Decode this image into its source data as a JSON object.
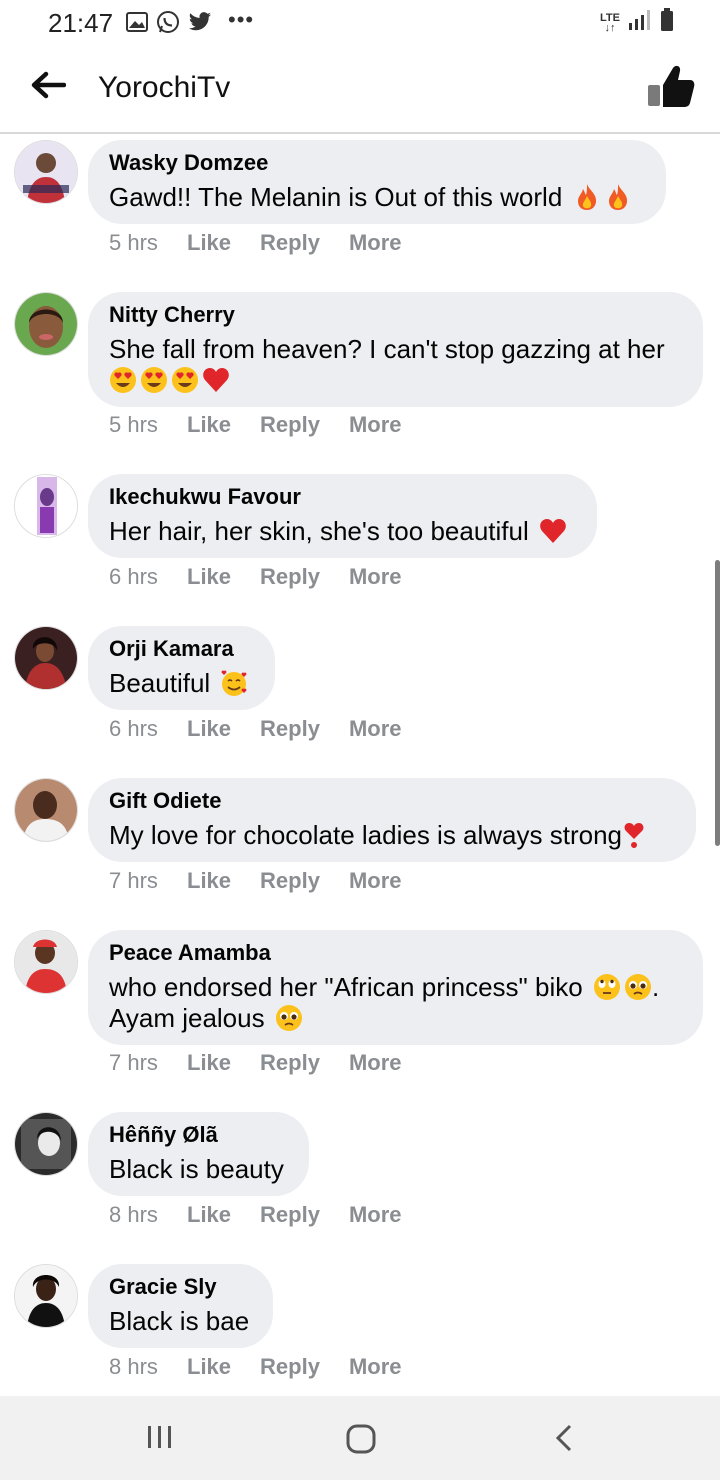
{
  "status": {
    "time": "21:47",
    "left_icons": [
      "gallery-icon",
      "whatsapp-icon",
      "twitter-icon",
      "more-dots-icon"
    ],
    "network": "LTE",
    "right_icons": [
      "lte-icon",
      "signal-icon",
      "battery-icon"
    ]
  },
  "header": {
    "title": "YorochiTv",
    "back_icon": "back-arrow-icon",
    "like_icon": "thumbs-up-icon"
  },
  "actions": {
    "like": "Like",
    "reply": "Reply",
    "more": "More"
  },
  "comments": [
    {
      "author": "Wasky Domzee",
      "lines": [
        "Gawd!! The Melanin is Out of this world"
      ],
      "emojis": [
        "fire",
        "fire"
      ],
      "time": "5 hrs"
    },
    {
      "author": "Nitty Cherry",
      "lines": [
        "She fall from heaven? I can't stop gazzing at her",
        ""
      ],
      "emojis": [
        "heart-eyes",
        "heart-eyes",
        "heart-eyes",
        "red-heart"
      ],
      "time": "5 hrs"
    },
    {
      "author": "Ikechukwu Favour",
      "lines": [
        "Her hair, her skin, she's too beautiful"
      ],
      "emojis": [
        "red-heart"
      ],
      "time": "6 hrs"
    },
    {
      "author": "Orji Kamara",
      "lines": [
        "Beautiful"
      ],
      "emojis": [
        "smiling-face-with-hearts"
      ],
      "time": "6 hrs"
    },
    {
      "author": "Gift Odiete",
      "lines": [
        "My love for chocolate ladies is always strong"
      ],
      "emojis": [
        "heart-exclamation"
      ],
      "time": "7 hrs"
    },
    {
      "author": "Peace Amamba",
      "lines": [
        "who endorsed her \"African princess\" biko",
        "Ayam jealous"
      ],
      "emojis": [
        "eye-roll",
        "pleading",
        "pleading"
      ],
      "line1_suffix": ".",
      "time": "7 hrs"
    },
    {
      "author": "Hêññy Ølã",
      "lines": [
        "Black is beauty"
      ],
      "emojis": [],
      "time": "8 hrs"
    },
    {
      "author": "Gracie Sly",
      "lines": [
        "Black is bae"
      ],
      "emojis": [],
      "time": "8 hrs"
    }
  ],
  "nav": {
    "icons": [
      "recent-apps-icon",
      "home-icon",
      "back-icon"
    ]
  },
  "colors": {
    "bubble": "#eceef1",
    "meta_text": "#8a8d91",
    "nav_bar": "#f1f1f1"
  }
}
